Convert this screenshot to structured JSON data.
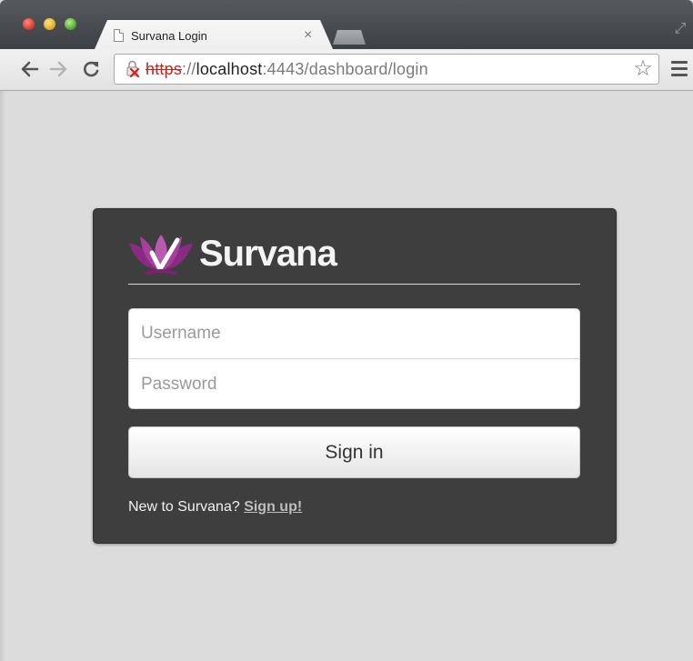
{
  "browser": {
    "tab": {
      "title": "Survana Login",
      "close_glyph": "×"
    },
    "nav": {
      "back_icon": "arrow-left-icon",
      "forward_icon": "arrow-right-icon",
      "reload_icon": "reload-icon"
    },
    "address": {
      "scheme": "https",
      "separator": "://",
      "host": "localhost",
      "rest": ":4443/dashboard/login"
    },
    "icons": [
      "broken-lock-icon",
      "star-icon",
      "menu-icon",
      "fullscreen-icon"
    ]
  },
  "login": {
    "brand": "Survana",
    "username_placeholder": "Username",
    "password_placeholder": "Password",
    "submit_label": "Sign in",
    "signup_prompt": "New to Survana?",
    "signup_link": "Sign up!"
  },
  "colors": {
    "page_bg": "#dcdcdc",
    "card_bg": "#3e3e3e",
    "logo_purple": "#9b2d8f",
    "insecure_red": "#c0281f"
  }
}
